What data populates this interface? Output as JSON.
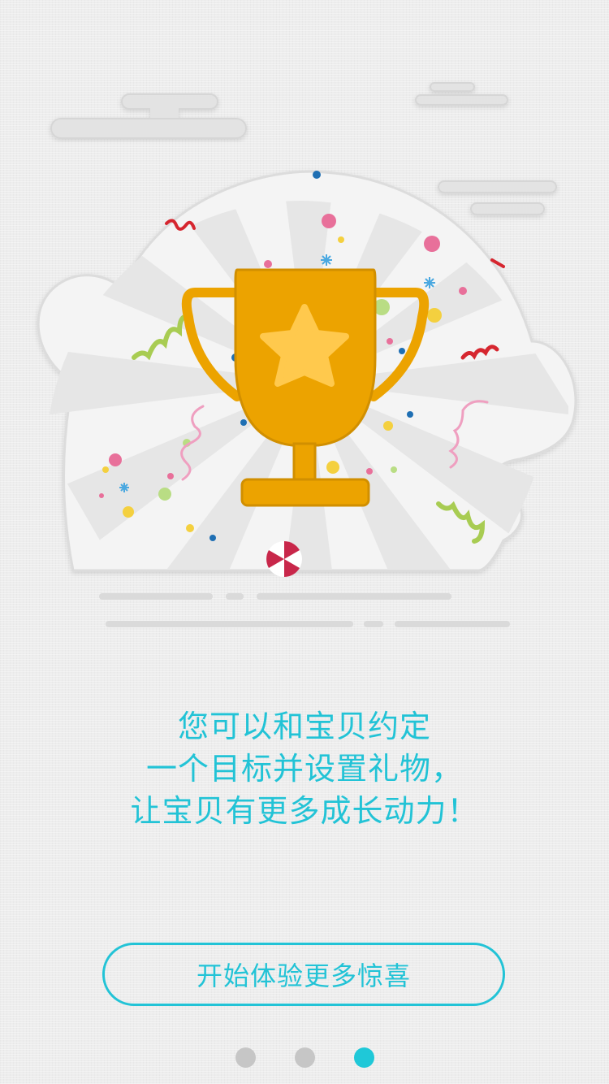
{
  "message": {
    "line1": "您可以和宝贝约定",
    "line2": "一个目标并设置礼物，",
    "line3": "让宝贝有更多成长动力！"
  },
  "cta": {
    "label": "开始体验更多惊喜"
  },
  "pager": {
    "total": 3,
    "current": 3
  },
  "colors": {
    "accent": "#22c3d6",
    "trophy": "#eca300",
    "star": "#ffc94d",
    "dot_inactive": "#c6c6c6"
  },
  "icons": {
    "illustration": "trophy-celebration-illustration"
  }
}
